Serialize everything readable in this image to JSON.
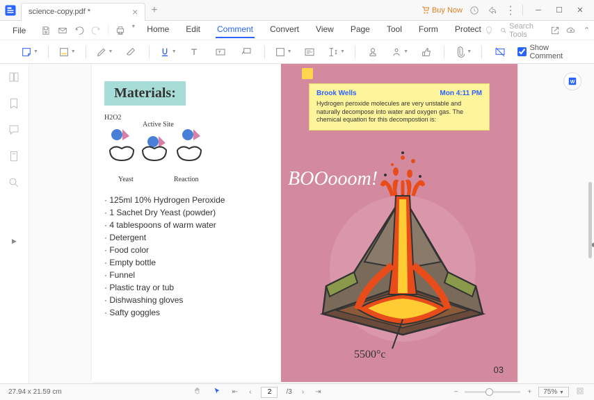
{
  "titlebar": {
    "tab_name": "science-copy.pdf *",
    "buy_now": "Buy Now"
  },
  "menu": {
    "file": "File",
    "items": [
      "Home",
      "Edit",
      "Comment",
      "Convert",
      "View",
      "Page",
      "Tool",
      "Form",
      "Protect"
    ],
    "active_index": 2,
    "search_placeholder": "Search Tools"
  },
  "toolbar": {
    "show_comment": "Show Comment"
  },
  "document": {
    "materials_heading": "Materials:",
    "diagram_labels": {
      "h2o2": "H2O2",
      "active_site": "Active Site",
      "yeast": "Yeast",
      "reaction": "Reaction"
    },
    "materials": [
      "125ml 10% Hydrogen Peroxide",
      "1 Sachet Dry Yeast (powder)",
      "4 tablespoons of warm water",
      "Detergent",
      "Food color",
      "Empty bottle",
      "Funnel",
      "Plastic tray or tub",
      "Dishwashing gloves",
      "Safty goggles"
    ],
    "boom_text": "BOOooom!",
    "temperature": "5500°c",
    "page_number": "03"
  },
  "comment": {
    "author": "Brook Wells",
    "time": "Mon 4:11 PM",
    "body": "Hydrogen peroxide molecules are very unstable and naturally decompose into water and oxygen gas. The chemical equation for this decompostion is:"
  },
  "statusbar": {
    "dimensions": "27.94 x 21.59 cm",
    "page_current": "2",
    "page_total": "/3",
    "zoom": "75%"
  }
}
